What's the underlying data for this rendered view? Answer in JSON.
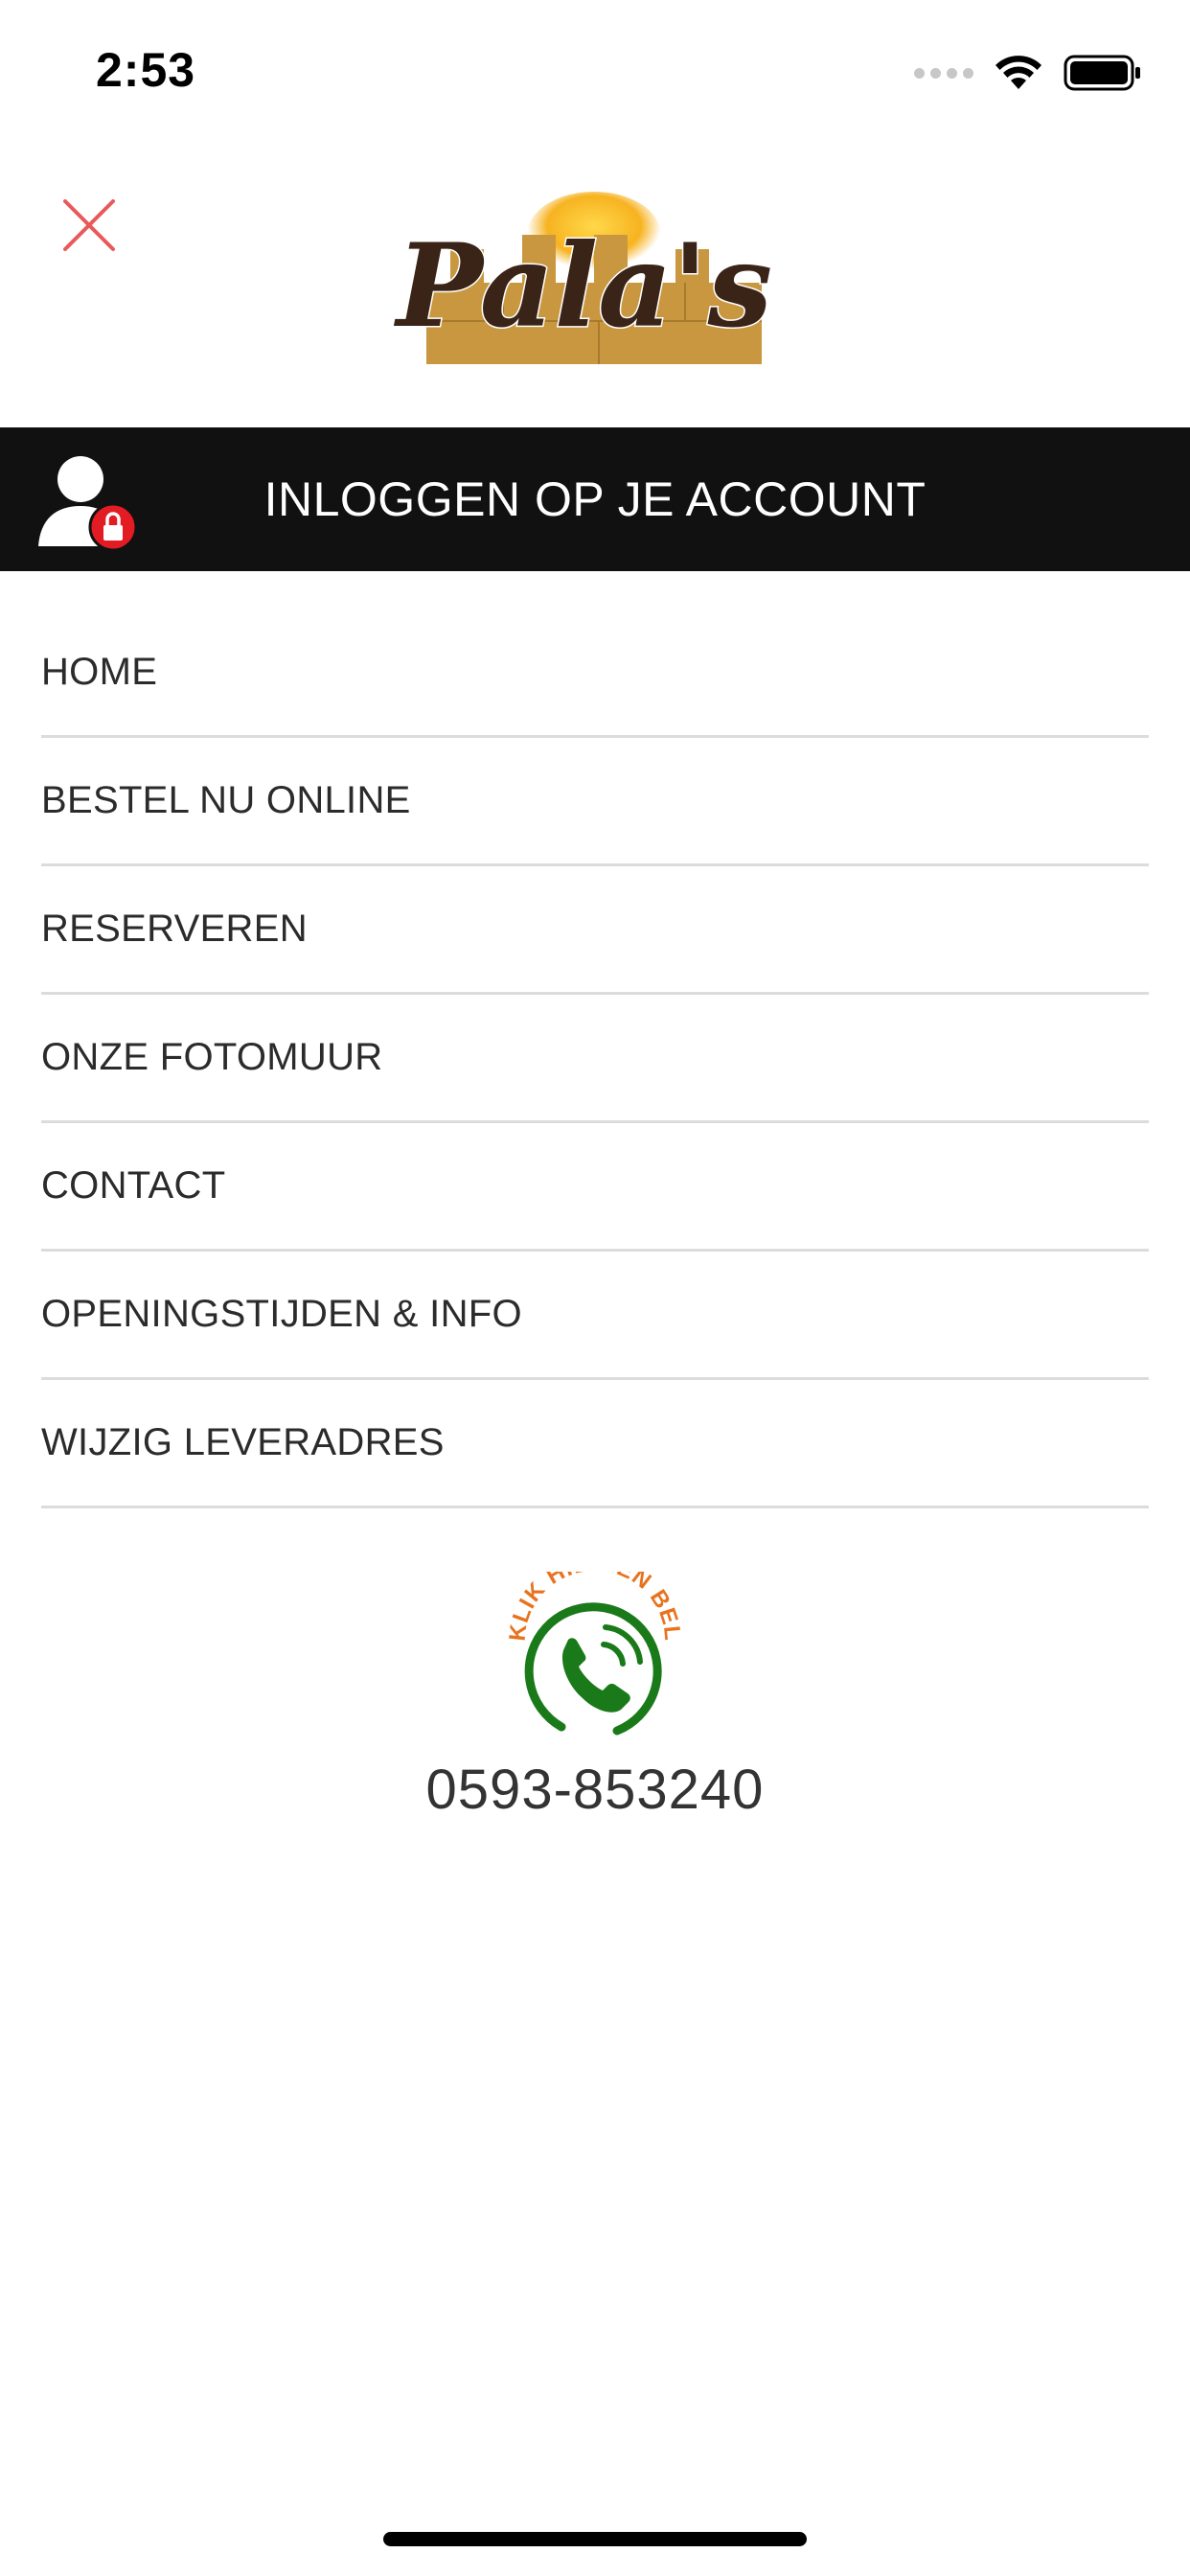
{
  "status_bar": {
    "time": "2:53",
    "icons": [
      "cellular-signal-icon",
      "wifi-icon",
      "battery-icon"
    ]
  },
  "header": {
    "close_icon": "close-icon",
    "logo_text": "Pala's"
  },
  "account": {
    "label": "INLOGGEN OP JE ACCOUNT",
    "icon": "user-lock-icon"
  },
  "menu": {
    "items": [
      {
        "label": "HOME"
      },
      {
        "label": "BESTEL NU ONLINE"
      },
      {
        "label": "RESERVEREN"
      },
      {
        "label": "ONZE FOTOMUUR"
      },
      {
        "label": "CONTACT"
      },
      {
        "label": "OPENINGSTIJDEN & INFO"
      },
      {
        "label": "WIJZIG LEVERADRES"
      }
    ]
  },
  "call": {
    "badge_text": "KLIK HIER EN BEL",
    "phone": "0593-853240",
    "icon": "phone-icon"
  },
  "colors": {
    "close": "#e85a5a",
    "account_bar": "#111111",
    "lock_badge": "#e31b23",
    "call_green": "#1a7a1a",
    "call_orange": "#e8731e",
    "divider": "#dcdcdc"
  }
}
